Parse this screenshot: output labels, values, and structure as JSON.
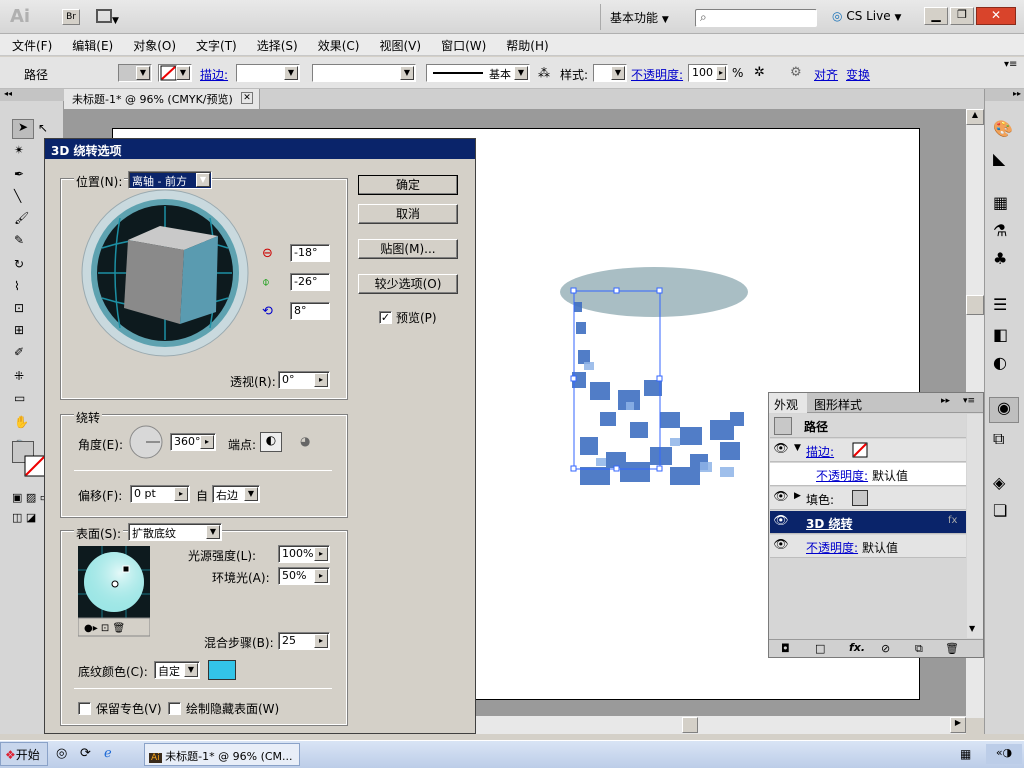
{
  "app": {
    "logo": "Ai",
    "bridge_label": "Br",
    "workspace": "基本功能",
    "search_placeholder": "",
    "cslive": "CS Live"
  },
  "menu": [
    "文件(F)",
    "编辑(E)",
    "对象(O)",
    "文字(T)",
    "选择(S)",
    "效果(C)",
    "视图(V)",
    "窗口(W)",
    "帮助(H)"
  ],
  "control_bar": {
    "object_type": "路径",
    "stroke_label": "描边:",
    "stroke_style": "基本",
    "style_label": "样式:",
    "opacity_label": "不透明度:",
    "opacity_value": "100",
    "opacity_unit": "%",
    "align_label": "对齐",
    "transform_label": "变换"
  },
  "document_tab": "未标题-1* @ 96% (CMYK/预览)",
  "dialog": {
    "title": "3D 绕转选项",
    "position_label": "位置(N):",
    "position_value": "离轴 - 前方",
    "rot_x": "-18°",
    "rot_y": "-26°",
    "rot_z": "8°",
    "perspective_label": "透视(R):",
    "perspective_value": "0°",
    "revolve_group": "绕转",
    "angle_label": "角度(E):",
    "angle_value": "360°",
    "cap_label": "端点:",
    "offset_label": "偏移(F):",
    "offset_value": "0 pt",
    "from_label": "自",
    "from_value": "右边",
    "surface_label": "表面(S):",
    "surface_value": "扩散底纹",
    "light_intensity_label": "光源强度(L):",
    "light_intensity_value": "100%",
    "ambient_label": "环境光(A):",
    "ambient_value": "50%",
    "blend_steps_label": "混合步骤(B):",
    "blend_steps_value": "25",
    "shade_color_label": "底纹颜色(C):",
    "shade_color_value": "自定",
    "shade_color": "#33c4e8",
    "preserve_spot_label": "保留专色(V)",
    "draw_hidden_label": "绘制隐藏表面(W)",
    "ok": "确定",
    "cancel": "取消",
    "map_art": "贴图(M)...",
    "fewer_options": "较少选项(O)",
    "preview_label": "预览(P)",
    "preview_checked": true
  },
  "appearance_panel": {
    "tab_appearance": "外观",
    "tab_graphic_styles": "图形样式",
    "path_label": "路径",
    "stroke_label": "描边:",
    "opacity_label": "不透明度:",
    "opacity_value": "默认值",
    "fill_label": "填色:",
    "effect_label": "3D 绕转",
    "opacity2_label": "不透明度:",
    "opacity2_value": "默认值"
  },
  "taskbar": {
    "start": "开始",
    "task": "未标题-1* @ 96% (CM..."
  }
}
